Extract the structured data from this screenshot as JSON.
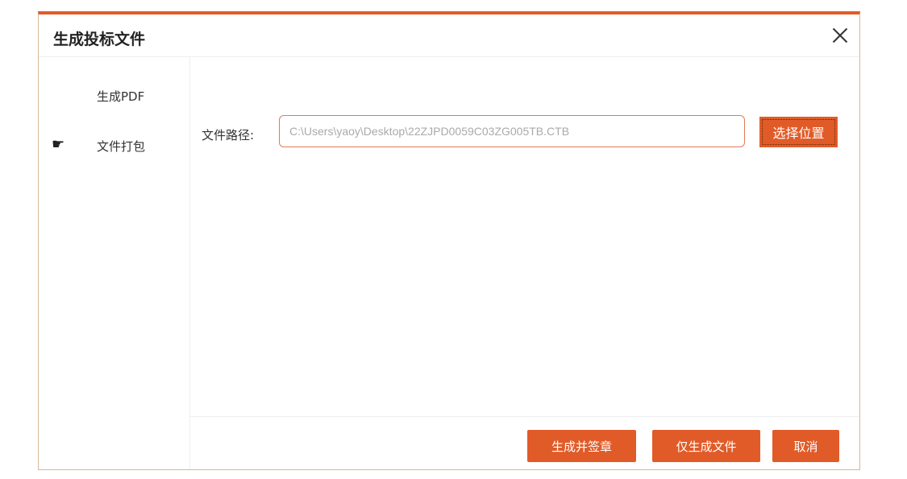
{
  "dialog": {
    "title": "生成投标文件"
  },
  "sidebar": {
    "items": [
      {
        "label": "生成PDF",
        "selected": false
      },
      {
        "label": "文件打包",
        "selected": true,
        "icon": "pointing-hand-icon"
      }
    ]
  },
  "form": {
    "path_label": "文件路径:",
    "path_value": "C:\\Users\\yaoy\\Desktop\\22ZJPD0059C03ZG005TB.CTB",
    "choose_button": "选择位置"
  },
  "footer": {
    "seal_button": "生成并签章",
    "generate_button": "仅生成文件",
    "cancel_button": "取消"
  },
  "colors": {
    "accent": "#e15b28",
    "input_border": "#e27a57"
  }
}
